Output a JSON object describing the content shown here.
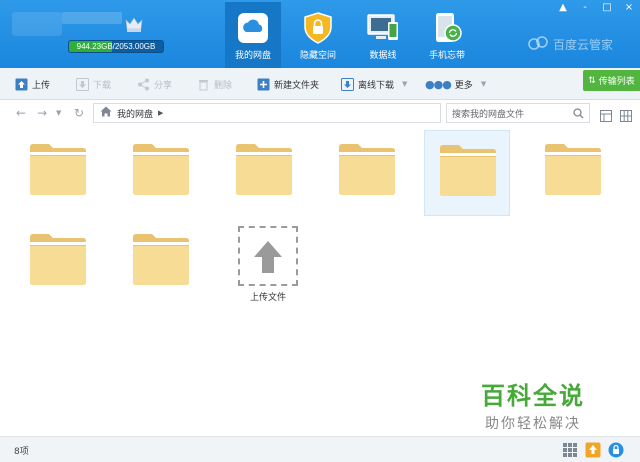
{
  "header": {
    "quota_text": "944.23GB/2053.00GB",
    "quota_used_fraction": 0.46,
    "nav": [
      {
        "label": "我的网盘",
        "icon": "cloud-icon"
      },
      {
        "label": "隐藏空间",
        "icon": "lock-icon"
      },
      {
        "label": "数据线",
        "icon": "devices-icon"
      },
      {
        "label": "手机忘带",
        "icon": "phone-sync-icon"
      }
    ],
    "brand": "百度云管家",
    "window_controls": [
      "▲",
      "-",
      "□",
      "×"
    ]
  },
  "toolbar": {
    "upload": "上传",
    "download": "下载",
    "share": "分享",
    "delete": "删除",
    "new_folder": "新建文件夹",
    "offline_download": "离线下载",
    "more": "更多",
    "transfer_list": "传输列表"
  },
  "address": {
    "breadcrumb": "我的网盘",
    "search_placeholder": "搜索我的网盘文件"
  },
  "content": {
    "folders_count": 8,
    "upload_label": "上传文件"
  },
  "watermark": {
    "title": "百科全说",
    "subtitle": "助你轻松解决"
  },
  "status": {
    "count_text": "8项"
  },
  "colors": {
    "header_blue": "#1a86dd",
    "accent_green": "#52b540",
    "folder_yellow": "#f7dc95"
  }
}
